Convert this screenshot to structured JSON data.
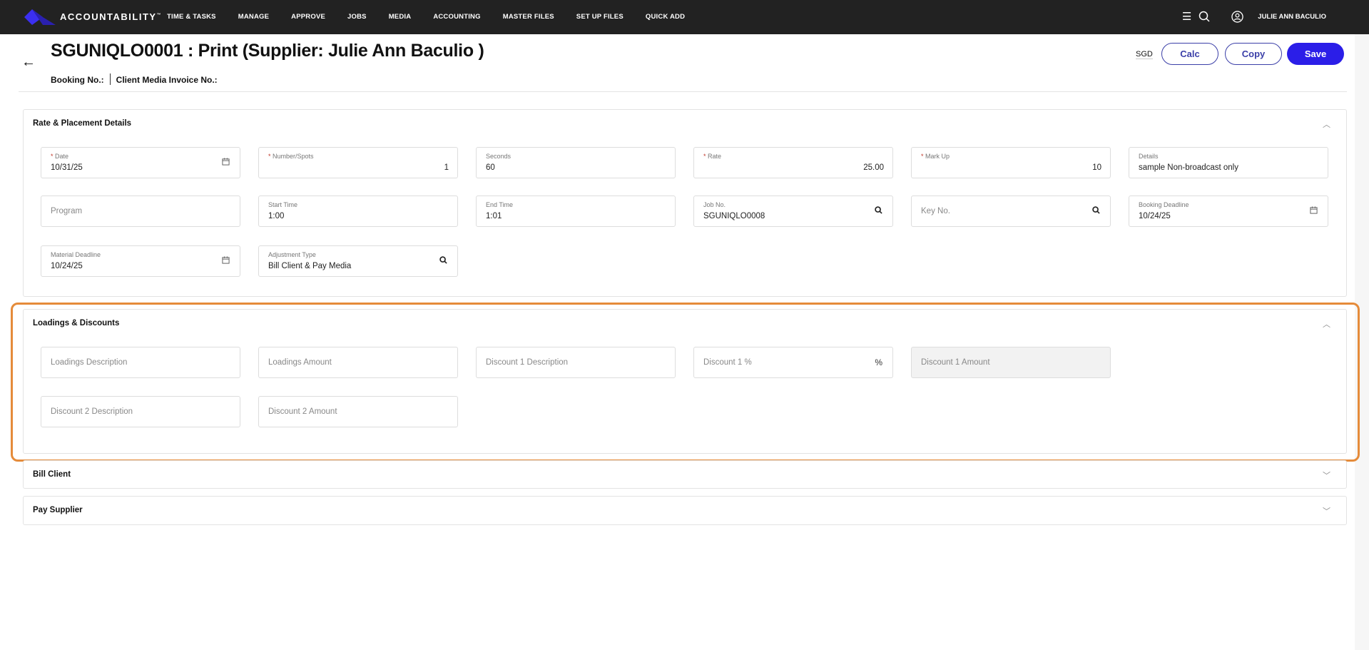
{
  "nav": {
    "brand": "ACCOUNTABILITY",
    "brand_mark": "™",
    "menu": [
      "TIME & TASKS",
      "MANAGE",
      "APPROVE",
      "JOBS",
      "MEDIA",
      "ACCOUNTING",
      "MASTER FILES",
      "SET UP FILES",
      "QUICK ADD"
    ],
    "user": "JULIE ANN BACULIO",
    "brand_color": "#3b2ff0"
  },
  "header": {
    "title": "SGUNIQLO0001 :  Print  (Supplier:  Julie Ann Baculio )",
    "booking": "Booking No.:",
    "invoice": "Client Media Invoice No.:",
    "currency": "SGD",
    "calc": "Calc",
    "copy": "Copy",
    "save": "Save"
  },
  "rate": {
    "title": "Rate & Placement Details",
    "fields": [
      {
        "label": "Date",
        "req": true,
        "value": "10/31/25",
        "icon": "calendar-icon"
      },
      {
        "label": "Number/Spots",
        "req": true,
        "value": "1",
        "align": "right"
      },
      {
        "label": "Seconds",
        "value": "60"
      },
      {
        "label": "Rate",
        "req": true,
        "value": "25.00",
        "align": "right"
      },
      {
        "label": "Mark Up",
        "req": true,
        "value": "10",
        "align": "right"
      },
      {
        "label": "Details",
        "value": "sample Non-broadcast only"
      },
      {
        "placeholder": "Program"
      },
      {
        "label": "Start Time",
        "value": "1:00"
      },
      {
        "label": "End Time",
        "value": "1:01"
      },
      {
        "label": "Job No.",
        "value": "SGUNIQLO0008",
        "icon": "search-icon"
      },
      {
        "placeholder": "Key No.",
        "icon": "search-icon"
      },
      {
        "label": "Booking Deadline",
        "value": "10/24/25",
        "icon": "calendar-icon"
      },
      {
        "label": "Material Deadline",
        "value": "10/24/25",
        "icon": "calendar-icon"
      },
      {
        "label": "Adjustment Type",
        "value": "Bill Client & Pay Media",
        "icon": "search-icon"
      }
    ]
  },
  "loadings": {
    "title": "Loadings & Discounts",
    "fields": [
      {
        "placeholder": "Loadings Description"
      },
      {
        "placeholder": "Loadings Amount"
      },
      {
        "placeholder": "Discount 1 Description"
      },
      {
        "placeholder": "Discount 1 %",
        "suffix": "%"
      },
      {
        "placeholder": "Discount 1 Amount",
        "disabled": true
      },
      {
        "placeholder": "Discount 2 Description"
      },
      {
        "placeholder": "Discount 2 Amount"
      }
    ]
  },
  "bill": {
    "title": "Bill Client"
  },
  "pay": {
    "title": "Pay Supplier"
  }
}
